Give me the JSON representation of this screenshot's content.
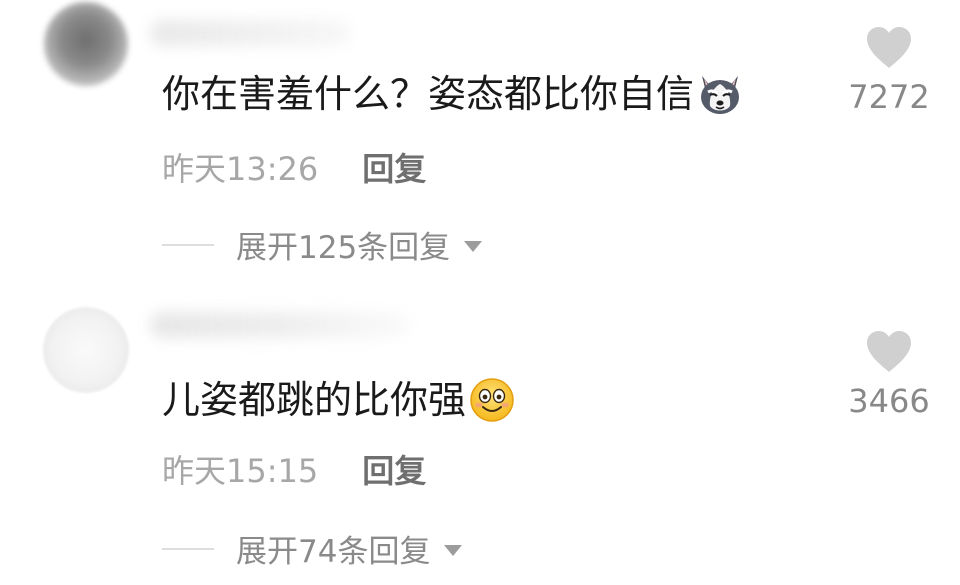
{
  "comments": [
    {
      "text": "你在害羞什么？姿态都比你自信",
      "emoji": "husky-face-emoji",
      "timestamp": "昨天13:26",
      "reply_label": "回复",
      "expand_label": "展开125条回复",
      "like_count": "7272"
    },
    {
      "text": "儿姿都跳的比你强",
      "emoji": "smiling-face-emoji",
      "timestamp": "昨天15:15",
      "reply_label": "回复",
      "expand_label": "展开74条回复",
      "like_count": "3466"
    }
  ],
  "colors": {
    "text": "#1a1a1a",
    "muted": "#a7a7a7",
    "reply": "#6f6f6f",
    "heart": "#d0d0d0"
  }
}
